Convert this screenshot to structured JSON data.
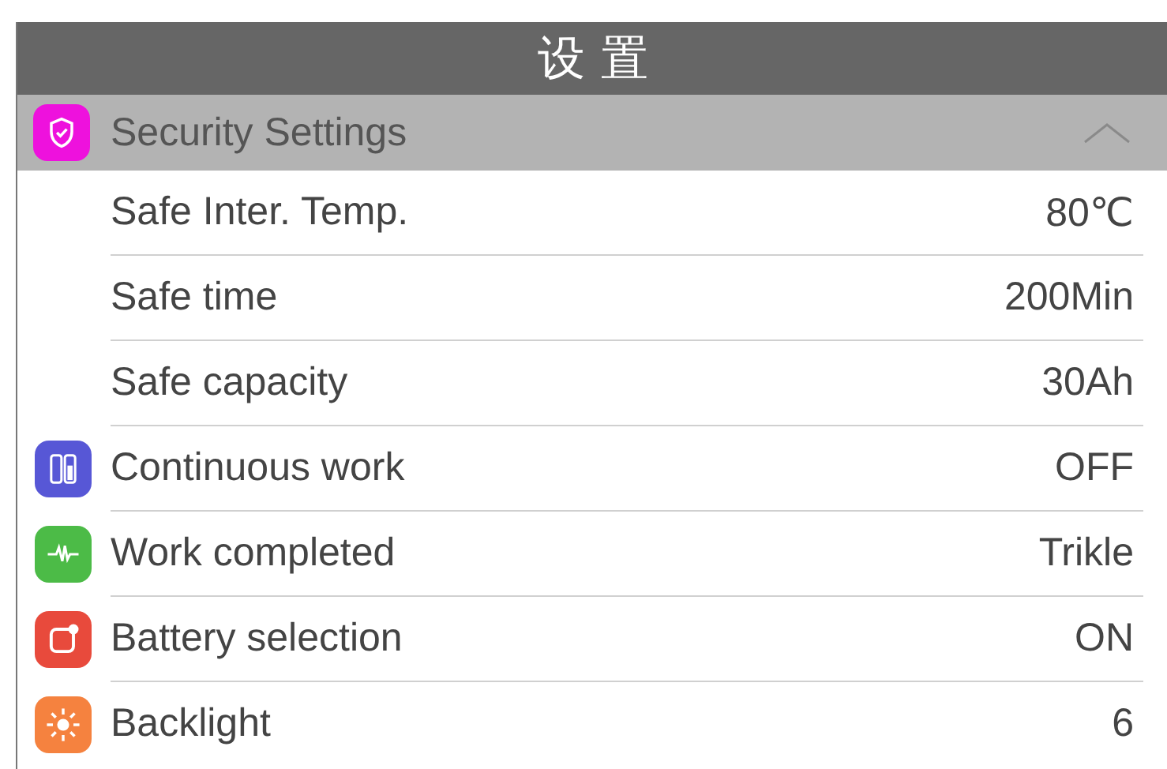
{
  "header": {
    "title": "设 置"
  },
  "section": {
    "label": "Security Settings",
    "color": "#ee11dd",
    "expanded": true,
    "children": [
      {
        "label": "Safe Inter. Temp.",
        "value": "80℃"
      },
      {
        "label": "Safe time",
        "value": "200Min"
      },
      {
        "label": "Safe capacity",
        "value": "30Ah"
      }
    ]
  },
  "settings": [
    {
      "label": "Continuous work",
      "value": "OFF",
      "color": "#5757d6"
    },
    {
      "label": "Work completed",
      "value": "Trikle",
      "color": "#4cbb47"
    },
    {
      "label": "Battery selection",
      "value": "ON",
      "color": "#e84a3c"
    },
    {
      "label": "Backlight",
      "value": "6",
      "color": "#f5823f"
    }
  ]
}
